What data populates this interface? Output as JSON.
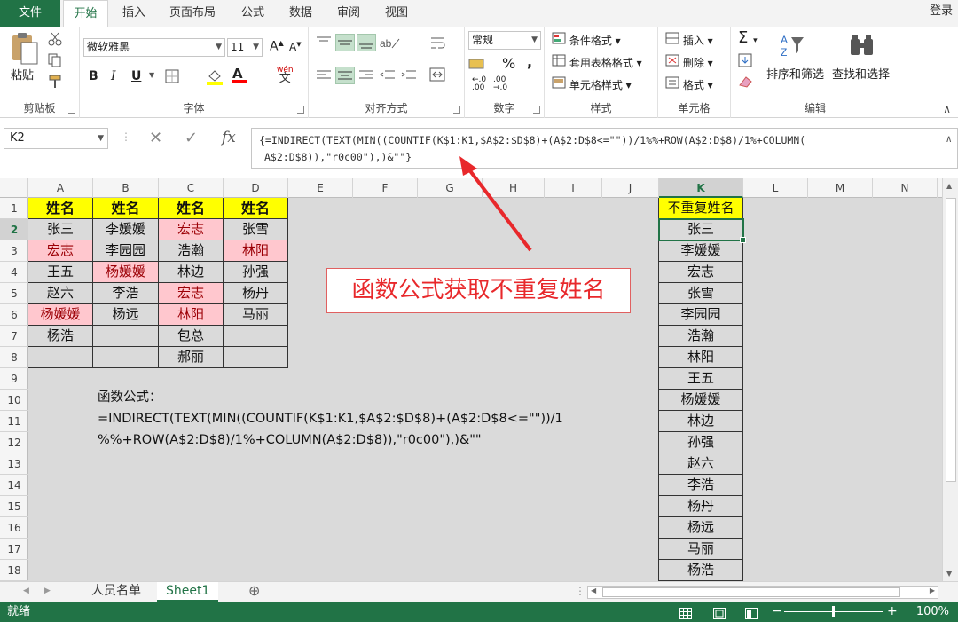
{
  "tabs": [
    "文件",
    "开始",
    "插入",
    "页面布局",
    "公式",
    "数据",
    "审阅",
    "视图"
  ],
  "login": "登录",
  "ribbon": {
    "clipboard": {
      "paste": "粘贴",
      "label": "剪贴板"
    },
    "font": {
      "name": "微软雅黑",
      "size": "11",
      "grow": "A",
      "shrink": "A",
      "bold": "B",
      "italic": "I",
      "underline": "U",
      "color_glyph": "A",
      "wen": "wén",
      "wen_char": "文",
      "label": "字体"
    },
    "align": {
      "label": "对齐方式"
    },
    "number": {
      "format": "常规",
      "percent": "%",
      "comma": ",",
      "label": "数字",
      "inc_top": "←.0",
      "inc_bot": ".00",
      "dec_top": ".00",
      "dec_bot": "→.0"
    },
    "styles": {
      "conditional": "条件格式",
      "table": "套用表格格式",
      "cell_styles": "单元格样式",
      "label": "样式"
    },
    "cells": {
      "insert": "插入",
      "delete": "删除",
      "format": "格式",
      "label": "单元格"
    },
    "editing": {
      "sum": "Σ",
      "sort_glyph": "A/Z",
      "sort": "排序和筛选",
      "find": "查找和选择",
      "label": "编辑"
    }
  },
  "formula_bar": {
    "name_box": "K2",
    "fx": "fx",
    "line1": "{=INDIRECT(TEXT(MIN((COUNTIF(K$1:K1,$A$2:$D$8)+(A$2:D$8<=\"\"))/1%%+ROW(A$2:D$8)/1%+COLUMN(",
    "line2": "A$2:D$8)),\"r0c00\"),)&\"\"}"
  },
  "columns": [
    "A",
    "B",
    "C",
    "D",
    "E",
    "F",
    "G",
    "H",
    "I",
    "J",
    "K",
    "L",
    "M",
    "N"
  ],
  "rows": [
    "1",
    "2",
    "3",
    "4",
    "5",
    "6",
    "7",
    "8",
    "9",
    "10",
    "11",
    "12",
    "13",
    "14",
    "15",
    "16",
    "17",
    "18"
  ],
  "table": {
    "headers": [
      "姓名",
      "姓名",
      "姓名",
      "姓名"
    ],
    "cols": [
      [
        "张三",
        "宏志",
        "王五",
        "赵六",
        "杨媛媛",
        "杨浩",
        ""
      ],
      [
        "李媛媛",
        "李园园",
        "杨媛媛",
        "李浩",
        "杨远",
        "",
        ""
      ],
      [
        "宏志",
        "浩瀚",
        "林边",
        "宏志",
        "林阳",
        "包总",
        "郝丽"
      ],
      [
        "张雪",
        "林阳",
        "孙强",
        "杨丹",
        "马丽",
        "",
        ""
      ]
    ],
    "pink": [
      [
        0,
        1
      ],
      [
        0,
        4
      ],
      [
        1,
        2
      ],
      [
        2,
        0
      ],
      [
        2,
        3
      ],
      [
        2,
        4
      ],
      [
        3,
        1
      ]
    ]
  },
  "note": {
    "title": "函数公式：",
    "line1": "=INDIRECT(TEXT(MIN((COUNTIF(K$1:K1,$A$2:$D$8)+(A$2:D$8<=\"\"))/1",
    "line2": "%%+ROW(A$2:D$8)/1%+COLUMN(A$2:D$8)),\"r0c00\"),)&\"\""
  },
  "unique": {
    "header": "不重复姓名",
    "values": [
      "张三",
      "李媛媛",
      "宏志",
      "张雪",
      "李园园",
      "浩瀚",
      "林阳",
      "王五",
      "杨媛媛",
      "林边",
      "孙强",
      "赵六",
      "李浩",
      "杨丹",
      "杨远",
      "马丽",
      "杨浩"
    ]
  },
  "callout": "函数公式获取不重复姓名",
  "sheets": [
    "人员名单",
    "Sheet1"
  ],
  "status": {
    "ready": "就绪",
    "zoom": "100%",
    "zoom_level": 0.5
  },
  "colors": {
    "accent": "#217346",
    "header_yellow": "#ffff00",
    "pink": "#ffc7ce",
    "pink_text": "#9c0006",
    "callout_red": "#e8282b"
  }
}
